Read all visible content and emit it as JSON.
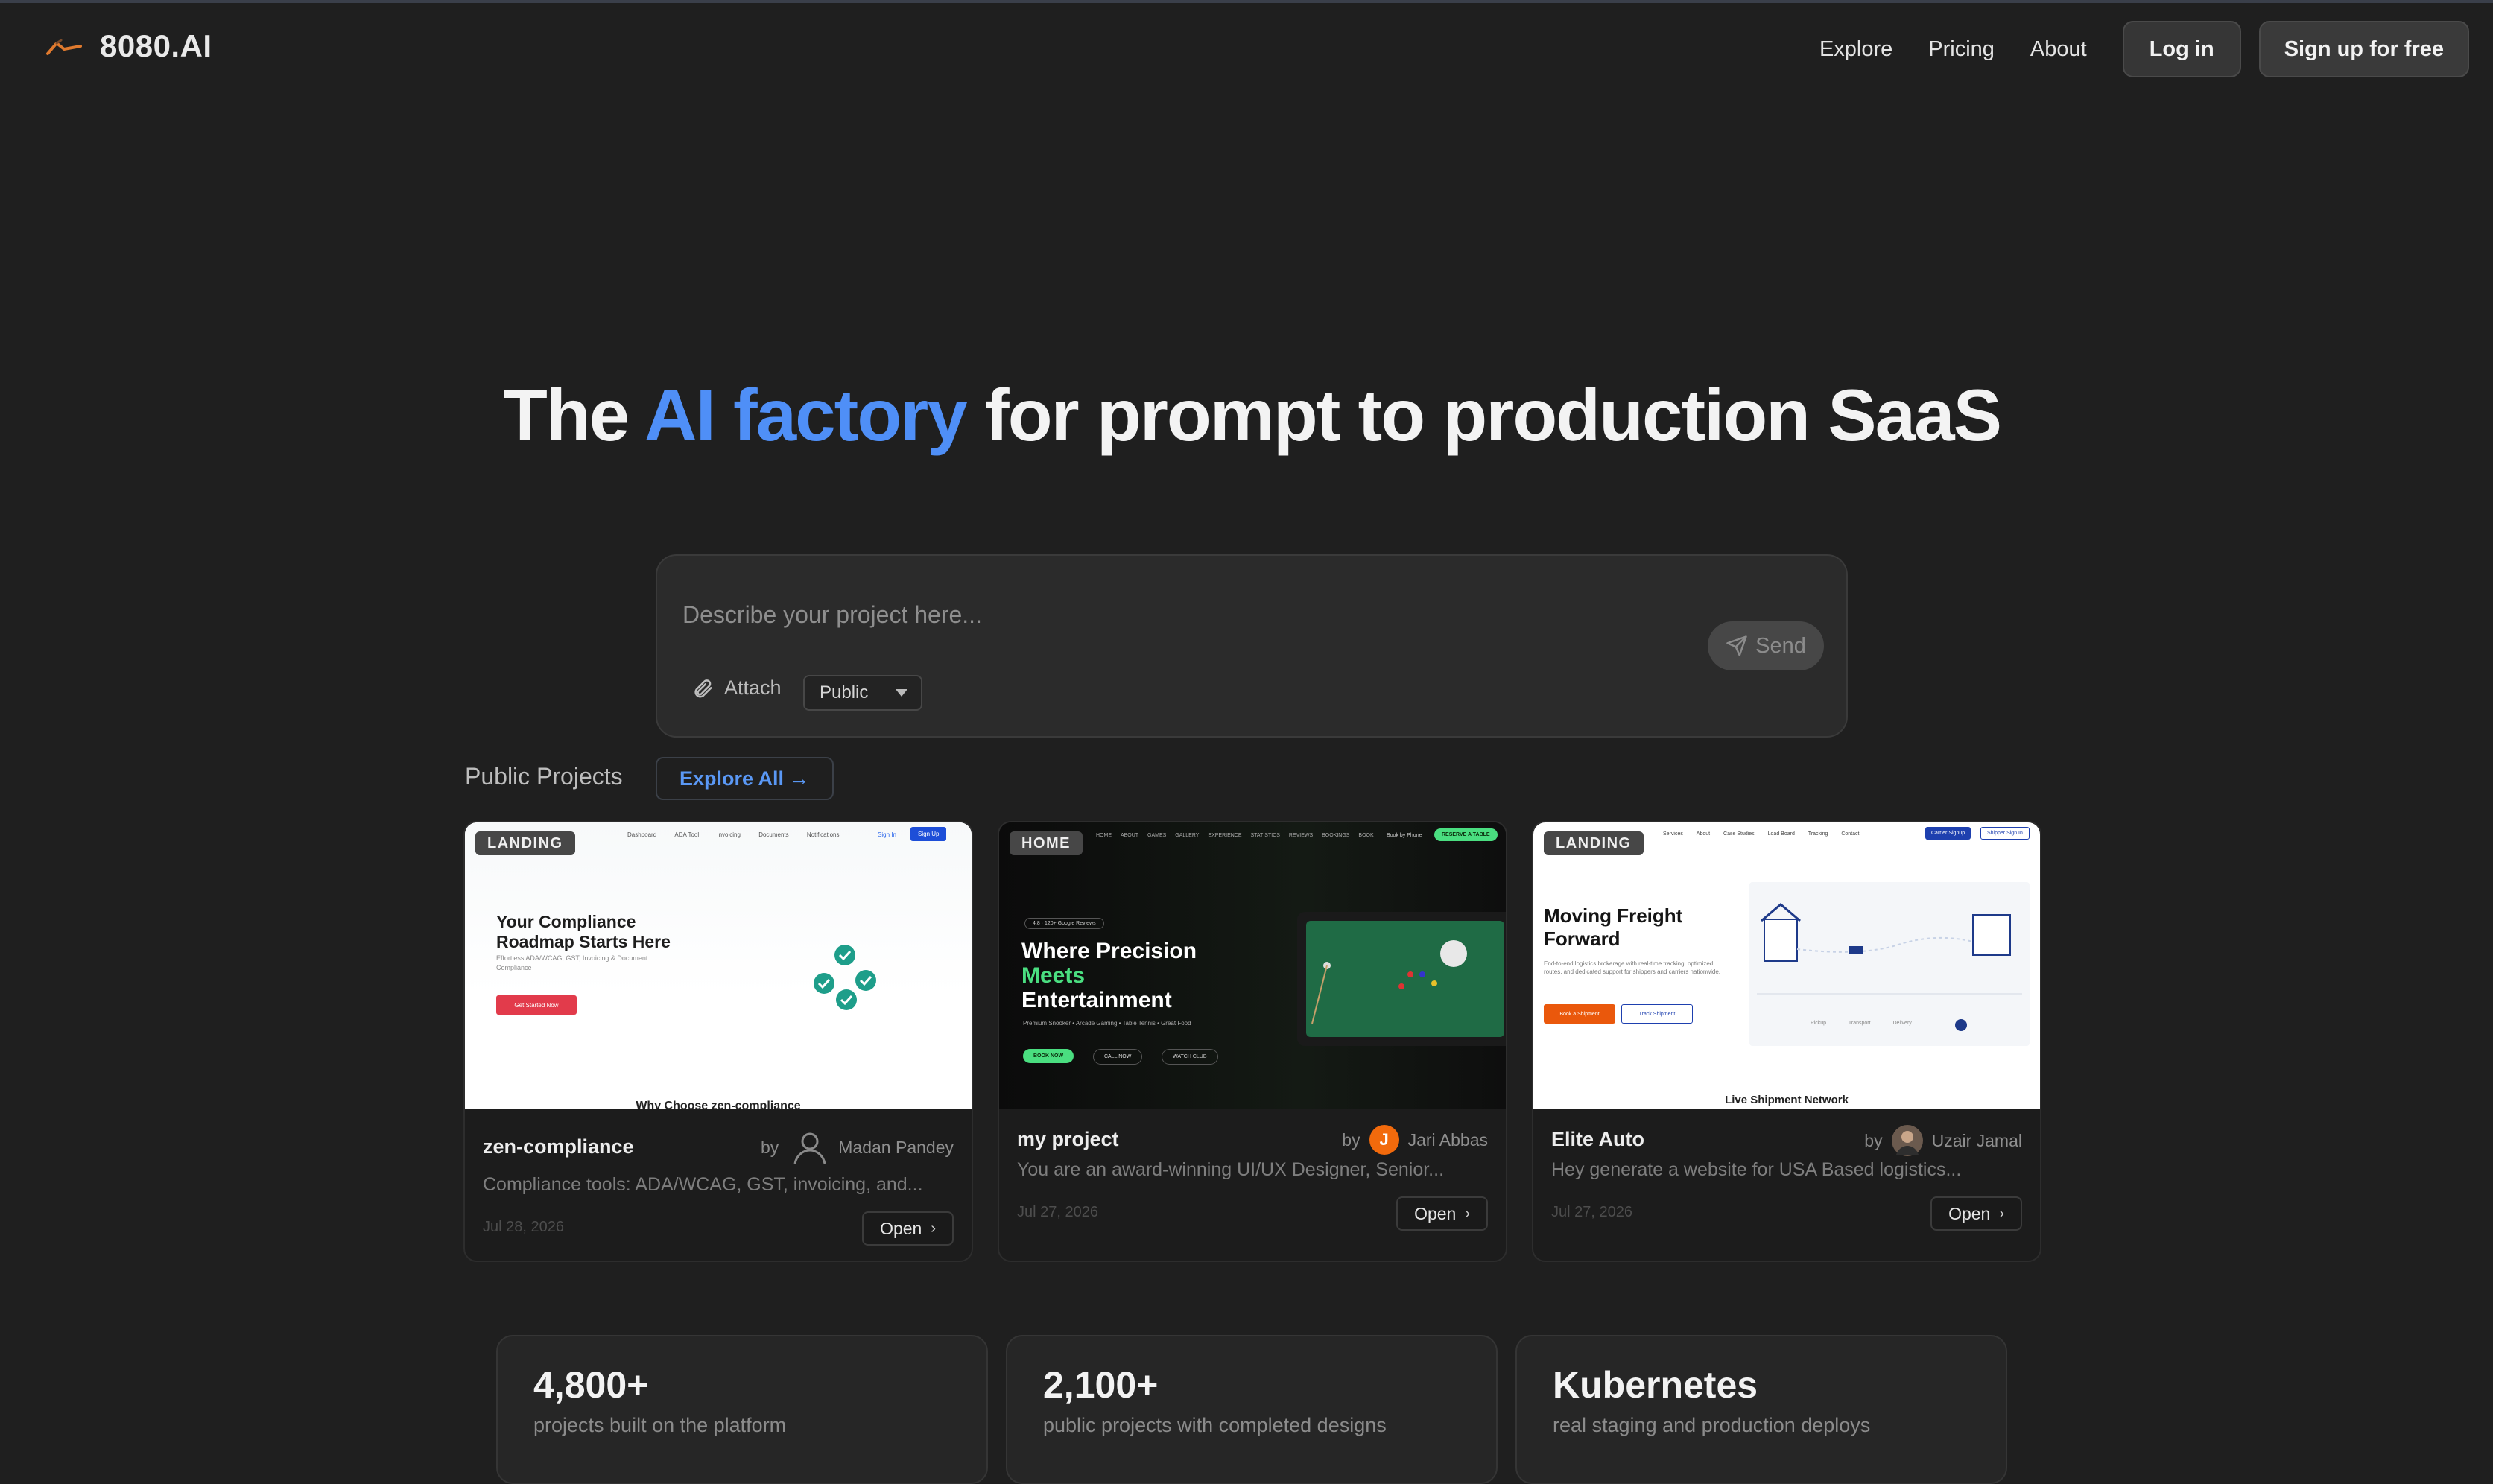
{
  "brand": {
    "name": "8080.AI"
  },
  "nav": {
    "links": [
      "Explore",
      "Pricing",
      "About"
    ],
    "login": "Log in",
    "signup": "Sign up for free"
  },
  "hero": {
    "title_pre": "The ",
    "title_accent": "AI factory",
    "title_post": " for prompt to production SaaS"
  },
  "prompt": {
    "placeholder": "Describe your project here...",
    "attach": "Attach",
    "visibility": "Public",
    "send": "Send"
  },
  "projects": {
    "section_label": "Public Projects",
    "explore_all": "Explore All →",
    "open_label": "Open",
    "by_label": "by",
    "cards": [
      {
        "badge": "LANDING",
        "title": "zen-compliance",
        "author": "Madan Pandey",
        "desc": "Compliance tools: ADA/WCAG, GST, invoicing, and...",
        "date": "Jul 28, 2026",
        "thumb": {
          "nav": [
            "Dashboard",
            "ADA Tool",
            "Invoicing",
            "Documents",
            "Notifications"
          ],
          "signin": "Sign In",
          "signup": "Sign Up",
          "headline": "Your Compliance Roadmap Starts Here",
          "sub": "Effortless ADA/WCAG, GST, Invoicing & Document Compliance",
          "cta": "Get Started Now",
          "footer": "Why Choose zen-compliance"
        }
      },
      {
        "badge": "HOME",
        "title": "my project",
        "author": "Jari Abbas",
        "author_initial": "J",
        "desc": "You are an award-winning UI/UX Designer, Senior...",
        "date": "Jul 27, 2026",
        "thumb": {
          "nav": [
            "HOME",
            "ABOUT",
            "GAMES",
            "GALLERY",
            "EXPERIENCE",
            "STATISTICS",
            "REVIEWS",
            "BOOKINGS",
            "BOOK"
          ],
          "book_now": "Book by Phone",
          "reserve": "RESERVE A TABLE",
          "rating": "4.8 · 120+ Google Reviews",
          "line1": "Where Precision",
          "line2": "Meets",
          "line3": "Entertainment",
          "sub": "Premium Snooker • Arcade Gaming • Table Tennis • Great Food",
          "cta1": "BOOK NOW",
          "cta2": "CALL NOW",
          "cta3": "WATCH CLUB"
        }
      },
      {
        "badge": "LANDING",
        "title": "Elite Auto",
        "author": "Uzair Jamal",
        "desc": "Hey generate a website for USA Based logistics...",
        "date": "Jul 27, 2026",
        "thumb": {
          "nav": [
            "Services",
            "About",
            "Case Studies",
            "Load Board",
            "Tracking",
            "Contact"
          ],
          "carrier": "Carrier Signup",
          "shipper": "Shipper Sign In",
          "headline": "Moving Freight Forward",
          "sub": "End-to-end logistics brokerage with real-time tracking, optimized routes, and dedicated support for shippers and carriers nationwide.",
          "cta1": "Book a Shipment",
          "cta2": "Track Shipment",
          "steps": [
            "Pickup",
            "Transport",
            "Delivery"
          ],
          "footer": "Live Shipment Network"
        }
      }
    ]
  },
  "stats": [
    {
      "value": "4,800+",
      "label": "projects built on the platform"
    },
    {
      "value": "2,100+",
      "label": "public projects with completed designs"
    },
    {
      "value": "Kubernetes",
      "label": "real staging and production deploys"
    }
  ]
}
